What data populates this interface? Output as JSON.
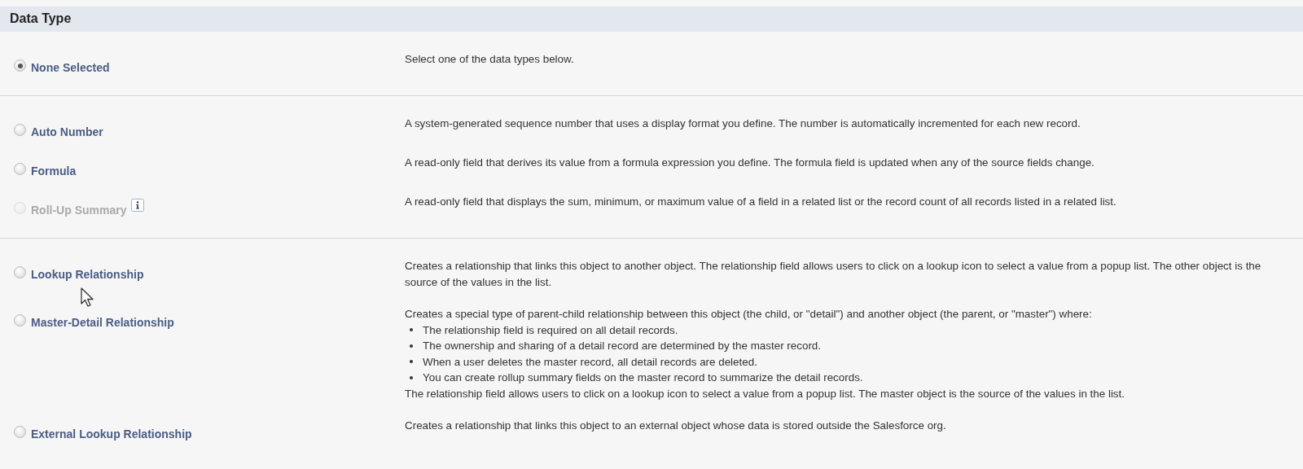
{
  "section": {
    "title": "Data Type"
  },
  "groups": [
    {
      "options": [
        {
          "label": "None Selected",
          "selected": true,
          "disabled": false,
          "info": false,
          "description": "Select one of the data types below."
        }
      ]
    },
    {
      "options": [
        {
          "label": "Auto Number",
          "selected": false,
          "disabled": false,
          "info": false,
          "description": "A system-generated sequence number that uses a display format you define. The number is automatically incremented for each new record."
        },
        {
          "label": "Formula",
          "selected": false,
          "disabled": false,
          "info": false,
          "description": "A read-only field that derives its value from a formula expression you define. The formula field is updated when any of the source fields change."
        },
        {
          "label": "Roll-Up Summary",
          "selected": false,
          "disabled": true,
          "info": true,
          "description": "A read-only field that displays the sum, minimum, or maximum value of a field in a related list or the record count of all records listed in a related list."
        }
      ]
    },
    {
      "options": [
        {
          "label": "Lookup Relationship",
          "selected": false,
          "disabled": false,
          "info": false,
          "hovered": true,
          "description": "Creates a relationship that links this object to another object. The relationship field allows users to click on a lookup icon to select a value from a popup list. The other object is the source of the values in the list."
        },
        {
          "label": "Master-Detail Relationship",
          "selected": false,
          "disabled": false,
          "info": false,
          "description": "Creates a special type of parent-child relationship between this object (the child, or \"detail\") and another object (the parent, or \"master\") where:",
          "bullets": [
            "The relationship field is required on all detail records.",
            "The ownership and sharing of a detail record are determined by the master record.",
            "When a user deletes the master record, all detail records are deleted.",
            "You can create rollup summary fields on the master record to summarize the detail records."
          ],
          "note": "The relationship field allows users to click on a lookup icon to select a value from a popup list. The master object is the source of the values in the list."
        },
        {
          "label": "External Lookup Relationship",
          "selected": false,
          "disabled": false,
          "info": false,
          "description": "Creates a relationship that links this object to an external object whose data is stored outside the Salesforce org."
        }
      ]
    }
  ]
}
